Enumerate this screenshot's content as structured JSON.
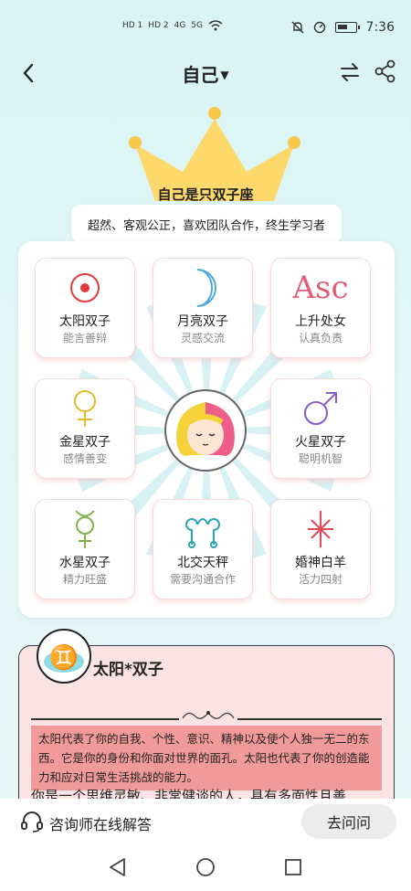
{
  "status_bar": {
    "time": "7:36",
    "indicators": [
      "HD 1",
      "HD 2",
      "4G",
      "5G"
    ],
    "icons": [
      "wifi-icon",
      "mute-icon",
      "alarm-icon",
      "battery-icon"
    ]
  },
  "header": {
    "title": "自己",
    "back_icon": "chevron-left-icon",
    "dropdown_icon": "caret-down-icon",
    "switch_icon": "swap-arrows-icon",
    "share_icon": "share-icon"
  },
  "hero": {
    "crown_title": "自己是只双子座",
    "tagline": "超然、客观公正，喜欢团队合作，终生学习者",
    "crown_color": "#fdd86a"
  },
  "tiles": [
    {
      "symbol": "sun-icon",
      "name": "太阳双子",
      "desc": "能言善辩"
    },
    {
      "symbol": "moon-icon",
      "name": "月亮双子",
      "desc": "灵感交流"
    },
    {
      "symbol": "Asc",
      "name": "上升处女",
      "desc": "认真负责"
    },
    {
      "symbol": "venus-icon",
      "name": "金星双子",
      "desc": "感情善变"
    },
    {
      "symbol": "mars-icon",
      "name": "火星双子",
      "desc": "聪明机智"
    },
    {
      "symbol": "mercury-icon",
      "name": "水星双子",
      "desc": "精力旺盛"
    },
    {
      "symbol": "north-node-icon",
      "name": "北交天秤",
      "desc": "需要沟通合作"
    },
    {
      "symbol": "juno-icon",
      "name": "婚神白羊",
      "desc": "活力四射"
    }
  ],
  "detail": {
    "badge_symbol": "♊",
    "title": "太阳*双子",
    "text": "太阳代表了你的自我、个性、意识、精神以及使个人独一无二的东西。它是你的身份和你面对世界的面孔。太阳也代表了你的创造能力和应对日常生活挑战的能力。",
    "more": "你是一个思维灵敏、非常健谈的人，具有多面性且善"
  },
  "consult": {
    "label": "咨询师在线解答",
    "button": "去问问"
  },
  "colors": {
    "accent_red": "#e23b3b",
    "moon_blue": "#4fa9dd",
    "asc_pink": "#e0607a",
    "venus_yellow": "#e6b92a",
    "mars_purple": "#8a5cc4",
    "mercury_green": "#7fb24a",
    "node_teal": "#2aa7b4",
    "juno_red": "#e04a5a"
  }
}
